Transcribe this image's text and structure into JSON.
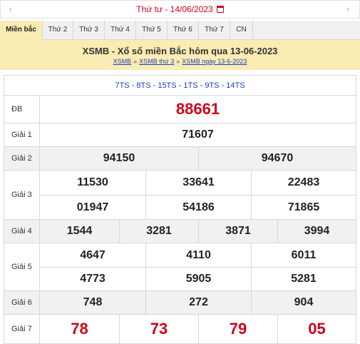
{
  "datebar": {
    "prev_icon": "‹",
    "next_icon": "›",
    "date_text": "Thứ tư -  14/06/2023",
    "calendar_icon": "calendar-icon"
  },
  "tabs": [
    "Miền bắc",
    "Thứ 2",
    "Thứ 3",
    "Thứ 4",
    "Thứ 5",
    "Thứ 6",
    "Thứ 7",
    "CN"
  ],
  "header": {
    "title": "XSMB - Xổ số miền Bắc hôm qua 13-06-2023",
    "crumbs": [
      "XSMB",
      "XSMB thứ 3",
      "XSMB ngày 13-6-2023"
    ],
    "separator": "»"
  },
  "results": {
    "codes": "7TS - 8TS - 15TS - 1TS - 9TS - 14TS",
    "labels": {
      "db": "ĐB",
      "g1": "Giải 1",
      "g2": "Giải 2",
      "g3": "Giải 3",
      "g4": "Giải 4",
      "g5": "Giải 5",
      "g6": "Giải 6",
      "g7": "Giải 7"
    },
    "db": "88661",
    "g1": "71607",
    "g2": [
      "94150",
      "94670"
    ],
    "g3": [
      "11530",
      "33641",
      "22483",
      "01947",
      "54186",
      "71865"
    ],
    "g4": [
      "1544",
      "3281",
      "3871",
      "3994"
    ],
    "g5": [
      "4647",
      "4110",
      "6011",
      "4773",
      "5905",
      "5281"
    ],
    "g6": [
      "748",
      "272",
      "904"
    ],
    "g7": [
      "78",
      "73",
      "79",
      "05"
    ]
  },
  "colors": {
    "accent_red": "#d0021b",
    "link_blue": "#1a3fc4",
    "header_bg": "#fbecb3"
  }
}
